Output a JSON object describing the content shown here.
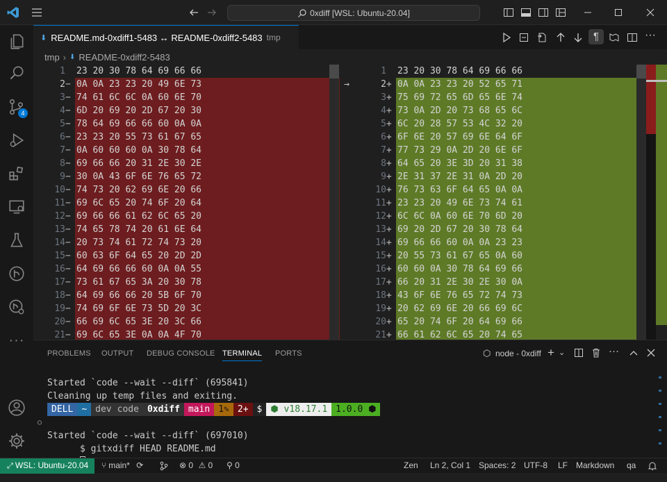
{
  "title": {
    "search_text": "0xdiff [WSL: Ubuntu-20.04]"
  },
  "tab": {
    "label": "README.md-0xdiff1-5483 ↔ README-0xdiff2-5483",
    "hint": "tmp"
  },
  "breadcrumb": {
    "folder": "tmp",
    "file": "README-0xdiff2-5483"
  },
  "left_lines": [
    {
      "n": "1",
      "m": "",
      "t": "23 20 30 78 64 69 66 66",
      "d": false
    },
    {
      "n": "2",
      "m": "−",
      "t": "0A 0A 23 23 20 49 6E 73",
      "d": true
    },
    {
      "n": "3",
      "m": "−",
      "t": "74 61 6C 6C 0A 60 6E 70",
      "d": true
    },
    {
      "n": "4",
      "m": "−",
      "t": "6D 20 69 20 2D 67 20 30",
      "d": true
    },
    {
      "n": "5",
      "m": "−",
      "t": "78 64 69 66 66 60 0A 0A",
      "d": true
    },
    {
      "n": "6",
      "m": "−",
      "t": "23 23 20 55 73 61 67 65",
      "d": true
    },
    {
      "n": "7",
      "m": "−",
      "t": "0A 60 60 60 0A 30 78 64",
      "d": true
    },
    {
      "n": "8",
      "m": "−",
      "t": "69 66 66 20 31 2E 30 2E",
      "d": true
    },
    {
      "n": "9",
      "m": "−",
      "t": "30 0A 43 6F 6E 76 65 72",
      "d": true
    },
    {
      "n": "10",
      "m": "−",
      "t": "74 73 20 62 69 6E 20 66",
      "d": true
    },
    {
      "n": "11",
      "m": "−",
      "t": "69 6C 65 20 74 6F 20 64",
      "d": true
    },
    {
      "n": "12",
      "m": "−",
      "t": "69 66 66 61 62 6C 65 20",
      "d": true
    },
    {
      "n": "13",
      "m": "−",
      "t": "74 65 78 74 20 61 6E 64",
      "d": true
    },
    {
      "n": "14",
      "m": "−",
      "t": "20 73 74 61 72 74 73 20",
      "d": true
    },
    {
      "n": "15",
      "m": "−",
      "t": "60 63 6F 64 65 20 2D 2D",
      "d": true
    },
    {
      "n": "16",
      "m": "−",
      "t": "64 69 66 66 60 0A 0A 55",
      "d": true
    },
    {
      "n": "17",
      "m": "−",
      "t": "73 61 67 65 3A 20 30 78",
      "d": true
    },
    {
      "n": "18",
      "m": "−",
      "t": "64 69 66 66 20 5B 6F 70",
      "d": true
    },
    {
      "n": "19",
      "m": "−",
      "t": "74 69 6F 6E 73 5D 20 3C",
      "d": true
    },
    {
      "n": "20",
      "m": "−",
      "t": "66 69 6C 65 3E 20 3C 66",
      "d": true
    },
    {
      "n": "21",
      "m": "−",
      "t": "69 6C 65 3E 0A 0A 4F 70",
      "d": true
    }
  ],
  "right_lines": [
    {
      "n": "1",
      "m": "",
      "t": "23 20 30 78 64 69 66 66",
      "d": false
    },
    {
      "n": "2",
      "m": "+",
      "t": "0A 0A 23 23 20 52 65 71",
      "d": true
    },
    {
      "n": "3",
      "m": "+",
      "t": "75 69 72 65 6D 65 6E 74",
      "d": true
    },
    {
      "n": "4",
      "m": "+",
      "t": "73 0A 2D 20 73 68 65 6C",
      "d": true
    },
    {
      "n": "5",
      "m": "+",
      "t": "6C 20 28 57 53 4C 32 20",
      "d": true
    },
    {
      "n": "6",
      "m": "+",
      "t": "6F 6E 20 57 69 6E 64 6F",
      "d": true
    },
    {
      "n": "7",
      "m": "+",
      "t": "77 73 29 0A 2D 20 6E 6F",
      "d": true
    },
    {
      "n": "8",
      "m": "+",
      "t": "64 65 20 3E 3D 20 31 38",
      "d": true
    },
    {
      "n": "9",
      "m": "+",
      "t": "2E 31 37 2E 31 0A 2D 20",
      "d": true
    },
    {
      "n": "10",
      "m": "+",
      "t": "76 73 63 6F 64 65 0A 0A",
      "d": true
    },
    {
      "n": "11",
      "m": "+",
      "t": "23 23 20 49 6E 73 74 61",
      "d": true
    },
    {
      "n": "12",
      "m": "+",
      "t": "6C 6C 0A 60 6E 70 6D 20",
      "d": true
    },
    {
      "n": "13",
      "m": "+",
      "t": "69 20 2D 67 20 30 78 64",
      "d": true
    },
    {
      "n": "14",
      "m": "+",
      "t": "69 66 66 60 0A 0A 23 23",
      "d": true
    },
    {
      "n": "15",
      "m": "+",
      "t": "20 55 73 61 67 65 0A 60",
      "d": true
    },
    {
      "n": "16",
      "m": "+",
      "t": "60 60 0A 30 78 64 69 66",
      "d": true
    },
    {
      "n": "17",
      "m": "+",
      "t": "66 20 31 2E 30 2E 30 0A",
      "d": true
    },
    {
      "n": "18",
      "m": "+",
      "t": "43 6F 6E 76 65 72 74 73",
      "d": true
    },
    {
      "n": "19",
      "m": "+",
      "t": "20 62 69 6E 20 66 69 6C",
      "d": true
    },
    {
      "n": "20",
      "m": "+",
      "t": "65 20 74 6F 20 64 69 66",
      "d": true
    },
    {
      "n": "21",
      "m": "+",
      "t": "66 61 62 6C 65 20 74 65",
      "d": true
    }
  ],
  "diff_arrow": "→",
  "panel_tabs": [
    "PROBLEMS",
    "OUTPUT",
    "DEBUG CONSOLE",
    "TERMINAL",
    "PORTS"
  ],
  "terminal_name": "node - 0xdiff",
  "terminal": {
    "line1": "Started `code --wait --diff` (695841)",
    "line2": "Cleaning up temp files and exiting.",
    "prompt": {
      "host": "DELL",
      "home": "~",
      "p1": "dev",
      "p2": "code",
      "p3": "0xdiff",
      "branch": "main",
      "edits": "1✎",
      "ahead": "2+",
      "dollar": "$",
      "node": "⬢ v18.17.1",
      "version": "1.0.0 ⬢"
    },
    "command": "$ gitxdiff HEAD README.md",
    "line4": "Started `code --wait --diff` (697010)"
  },
  "status": {
    "remote": "WSL: Ubuntu-20.04",
    "branch": "main*",
    "errors": "0",
    "warnings": "0",
    "ports": "0",
    "zen": "Zen",
    "position": "Ln 2, Col 1",
    "spaces": "Spaces: 2",
    "encoding": "UTF-8",
    "eol": "LF",
    "language": "Markdown",
    "extra": "qa"
  },
  "colors": {
    "accent": "#0078d4",
    "removed_bg": "#6d1d1f",
    "added_bg": "#5e7a27",
    "remote_bg": "#16825d"
  },
  "badge": {
    "scm_count": "4"
  }
}
